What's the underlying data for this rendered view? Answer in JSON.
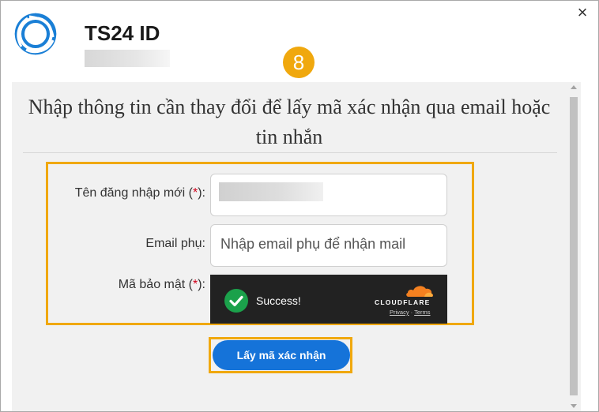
{
  "header": {
    "app_title": "TS24 ID",
    "close_label": "×",
    "step_badge": "8"
  },
  "form": {
    "heading": "Nhập thông tin cần thay đổi để lấy mã xác nhận qua email hoặc tin nhắn",
    "username_label": "Tên đăng nhập mới (",
    "username_req": "*",
    "username_suffix": "):",
    "email_label": "Email phụ:",
    "email_placeholder": "Nhập email phụ để nhận mail",
    "captcha_label": "Mã bảo mật (",
    "captcha_req": "*",
    "captcha_suffix": "):",
    "submit_label": "Lấy mã xác nhận"
  },
  "captcha_widget": {
    "status": "Success!",
    "brand": "CLOUDFLARE",
    "privacy": "Privacy",
    "separator": " · ",
    "terms": "Terms"
  },
  "colors": {
    "highlight": "#f0a80e",
    "primary": "#1573d9",
    "logo": "#1a7fd6",
    "required": "#d0021b",
    "success": "#1ba14b",
    "cloudflare_orange": "#f38020"
  }
}
